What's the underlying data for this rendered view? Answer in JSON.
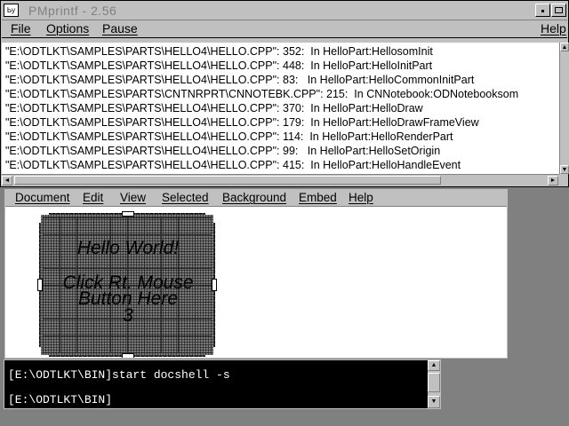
{
  "pmprintf": {
    "sysmenu_glyph": "Ьу",
    "title": "PMprintf - 2.56",
    "menu": {
      "file": "File",
      "options": "Options",
      "pause": "Pause",
      "help": "Help"
    },
    "lines": [
      "\"E:\\ODTLKT\\SAMPLES\\PARTS\\HELLO4\\HELLO.CPP\": 352:  In HelloPart:HellosomInit",
      "\"E:\\ODTLKT\\SAMPLES\\PARTS\\HELLO4\\HELLO.CPP\": 448:  In HelloPart:HelloInitPart",
      "\"E:\\ODTLKT\\SAMPLES\\PARTS\\HELLO4\\HELLO.CPP\": 83:   In HelloPart:HelloCommonInitPart",
      "\"E:\\ODTLKT\\SAMPLES\\PARTS\\CNTNRPRT\\CNNOTEBK.CPP\": 215:  In CNNotebook:ODNotebooksom",
      "\"E:\\ODTLKT\\SAMPLES\\PARTS\\HELLO4\\HELLO.CPP\": 370:  In HelloPart:HelloDraw",
      "\"E:\\ODTLKT\\SAMPLES\\PARTS\\HELLO4\\HELLO.CPP\": 179:  In HelloPart:HelloDrawFrameView",
      "\"E:\\ODTLKT\\SAMPLES\\PARTS\\HELLO4\\HELLO.CPP\": 114:  In HelloPart:HelloRenderPart",
      "\"E:\\ODTLKT\\SAMPLES\\PARTS\\HELLO4\\HELLO.CPP\": 99:   In HelloPart:HelloSetOrigin",
      "\"E:\\ODTLKT\\SAMPLES\\PARTS\\HELLO4\\HELLO.CPP\": 415:  In HelloPart:HelloHandleEvent"
    ]
  },
  "docshell": {
    "menu": [
      {
        "id": "document",
        "label": "Document"
      },
      {
        "id": "edit",
        "label": "Edit"
      },
      {
        "id": "view",
        "label": "View"
      },
      {
        "id": "selected",
        "label": "Selected"
      },
      {
        "id": "background",
        "label": "Background"
      },
      {
        "id": "embed",
        "label": "Embed"
      },
      {
        "id": "help",
        "label": "Help"
      }
    ],
    "part": {
      "line1": "Hello World!",
      "line2": "Click Rt. Mouse",
      "line3": "Button Here",
      "line4": "3"
    }
  },
  "cmd": {
    "line1": "[E:\\ODTLKT\\BIN]start docshell -s",
    "line2": "[E:\\ODTLKT\\BIN]"
  },
  "icons": {
    "up": "▲",
    "down": "▼",
    "left": "◄",
    "right": "►"
  }
}
